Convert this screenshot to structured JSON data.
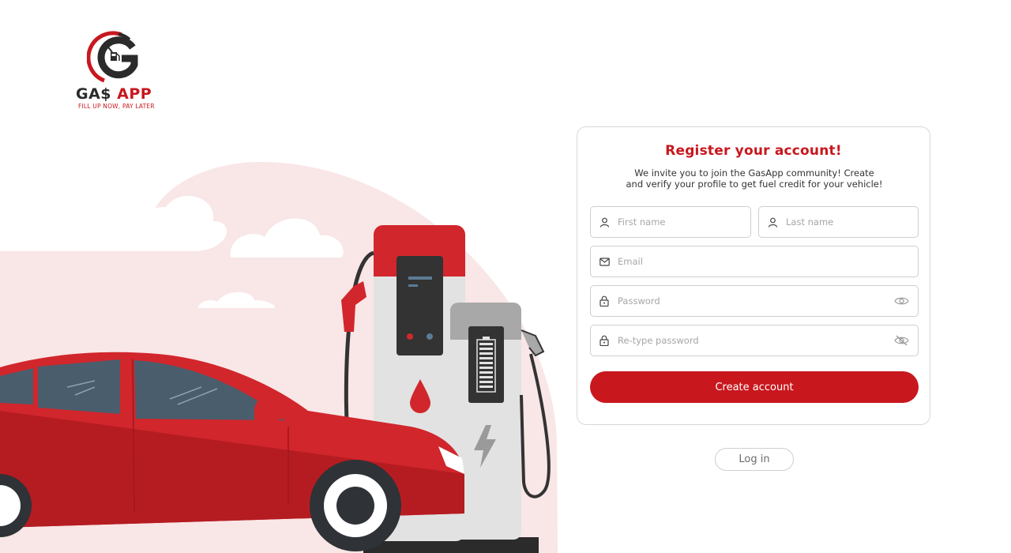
{
  "brand": {
    "logo_icon": "gas-app-gauge-logo",
    "name_part1": "GA$",
    "name_part2": "APP",
    "tagline": "FILL UP NOW, PAY LATER",
    "primary_color": "#c9171e",
    "dark_color": "#2b2b2b"
  },
  "register": {
    "title": "Register your account!",
    "subtitle": "We invite you to join the GasApp community! Create and verify your profile to get fuel credit for your vehicle!",
    "fields": {
      "first_name": {
        "placeholder": "First name",
        "value": "",
        "icon": "user-icon"
      },
      "last_name": {
        "placeholder": "Last name",
        "value": "",
        "icon": "user-icon"
      },
      "email": {
        "placeholder": "Email",
        "value": "",
        "icon": "mail-icon"
      },
      "password": {
        "placeholder": "Password",
        "value": "",
        "icon": "lock-icon",
        "toggle_icon": "eye-icon"
      },
      "retype_password": {
        "placeholder": "Re-type password",
        "value": "",
        "icon": "lock-icon",
        "toggle_icon": "eye-off-icon"
      }
    },
    "create_button": "Create account"
  },
  "login": {
    "button": "Log in"
  },
  "illustration": {
    "subject": "red-electric-car-at-charging-station",
    "accent_color": "#c9171e",
    "background_blob_color": "#f9e6e6"
  }
}
